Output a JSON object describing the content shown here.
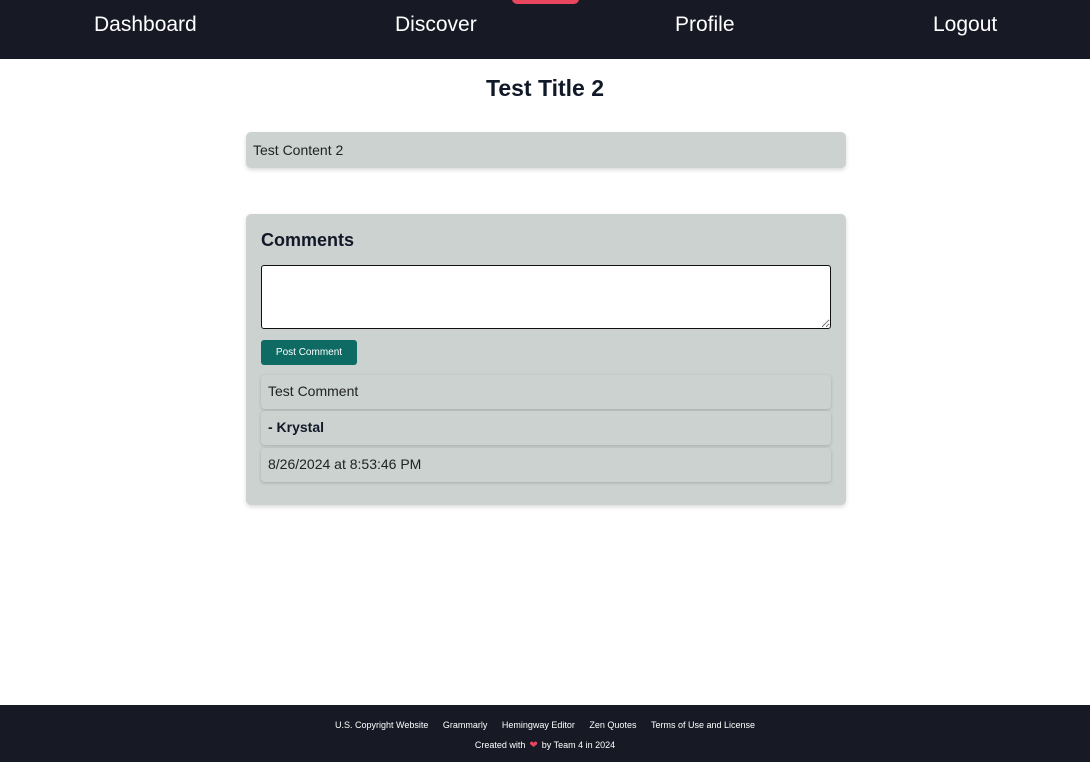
{
  "nav": {
    "dashboard": "Dashboard",
    "discover": "Discover",
    "profile": "Profile",
    "logout": "Logout"
  },
  "post": {
    "title": "Test Title 2",
    "content": "Test Content 2"
  },
  "comments": {
    "heading": "Comments",
    "input_value": "",
    "post_button": "Post Comment",
    "items": [
      {
        "text": "Test Comment",
        "author": "- Krystal",
        "date": "8/26/2024 at 8:53:46 PM"
      }
    ]
  },
  "footer": {
    "links": [
      "U.S. Copyright Website",
      "Grammarly",
      "Hemingway Editor",
      "Zen Quotes",
      "Terms of Use and License"
    ],
    "credit_before": "Created with",
    "credit_after": "by Team 4 in 2024"
  },
  "colors": {
    "nav_background": "#171925",
    "card_background": "#cbd2cf",
    "button_background": "#0e6b63",
    "accent": "#e8465e"
  },
  "icons": {
    "heart": "heart-icon"
  }
}
